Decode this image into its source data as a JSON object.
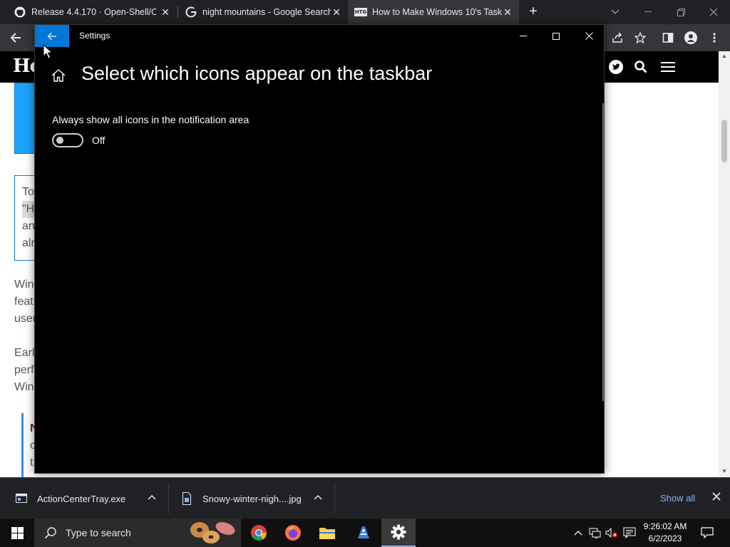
{
  "browser": {
    "tabs": [
      {
        "title": "Release 4.4.170 · Open-Shell/Ope",
        "icon": "github-icon",
        "active": false
      },
      {
        "title": "night mountains - Google Search",
        "icon": "google-icon",
        "active": false
      },
      {
        "title": "How to Make Windows 10's Task",
        "icon": "htg-icon",
        "active": true
      }
    ],
    "htg_favicon_text": "HTG"
  },
  "website": {
    "logo_text": "Ho",
    "fragments": {
      "quote_line1": "To",
      "quote_line2": "\"H",
      "quote_line3": "an",
      "quote_line4": "alr",
      "para1_line1": "Win",
      "para1_line2": "feat",
      "para1_line3": "user",
      "para2_line1": "Earl",
      "para2_line2": "perf",
      "para2_line3": "Win",
      "note_line1": "N",
      "note_line2": "c",
      "note_line3": "t"
    }
  },
  "settings": {
    "window_title": "Settings",
    "page_title": "Select which icons appear on the taskbar",
    "option_label": "Always show all icons in the notification area",
    "toggle_state": "Off"
  },
  "downloads": {
    "items": [
      {
        "name": "ActionCenterTray.exe"
      },
      {
        "name": "Snowy-winter-nigh....jpg"
      }
    ],
    "show_all": "Show all"
  },
  "taskbar": {
    "search_placeholder": "Type to search",
    "clock_time": "9:26:02 AM",
    "clock_date": "6/2/2023"
  },
  "colors": {
    "accent": "#0078d7",
    "settings_bg": "#000000",
    "browser_dark": "#202124",
    "link_blue": "#8ab4f8"
  }
}
